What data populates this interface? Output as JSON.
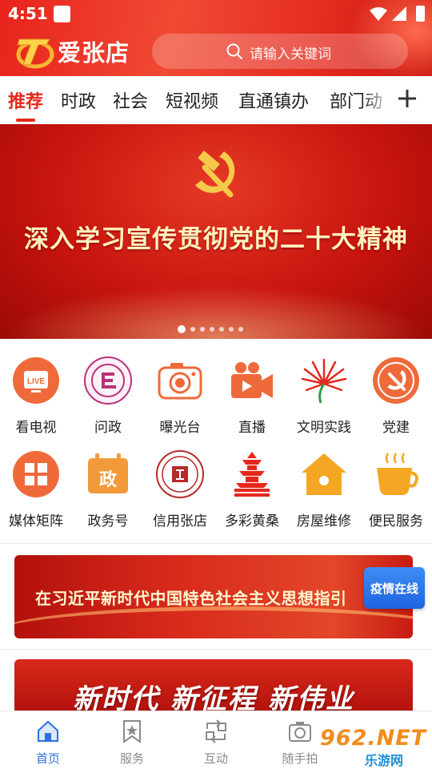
{
  "status_bar": {
    "time": "4:51"
  },
  "header": {
    "app_name": "爱张店",
    "search_placeholder": "请输入关键词"
  },
  "tabs": [
    {
      "label": "推荐",
      "active": true
    },
    {
      "label": "时政"
    },
    {
      "label": "社会"
    },
    {
      "label": "短视频"
    },
    {
      "label": "直通镇办"
    },
    {
      "label": "部门动"
    }
  ],
  "banner": {
    "text": "深入学习宣传贯彻党的二十大精神",
    "page_count": 7,
    "active_page": 1
  },
  "services": [
    {
      "label": "看电视",
      "icon": "live-tv-icon"
    },
    {
      "label": "问政",
      "icon": "wenzheng-icon"
    },
    {
      "label": "曝光台",
      "icon": "camera-icon"
    },
    {
      "label": "直播",
      "icon": "video-camera-icon"
    },
    {
      "label": "文明实践",
      "icon": "civilization-flower-icon"
    },
    {
      "label": "党建",
      "icon": "party-emblem-icon"
    },
    {
      "label": "媒体矩阵",
      "icon": "grid-matrix-icon"
    },
    {
      "label": "政务号",
      "icon": "gov-calendar-icon"
    },
    {
      "label": "信用张店",
      "icon": "credit-seal-icon"
    },
    {
      "label": "多彩黄桑",
      "icon": "pagoda-icon"
    },
    {
      "label": "房屋维修",
      "icon": "house-icon"
    },
    {
      "label": "便民服务",
      "icon": "coffee-cup-icon"
    }
  ],
  "promos": {
    "promo1_text": "在习近平新时代中国特色社会主义思想指引",
    "epidemic_badge": "疫情在线",
    "promo2_text": "新时代 新征程 新伟业"
  },
  "bottom_nav": [
    {
      "label": "首页",
      "active": true
    },
    {
      "label": "服务"
    },
    {
      "label": "互动"
    },
    {
      "label": "随手拍"
    }
  ],
  "watermark": {
    "top": "962.NET",
    "bottom": "乐游网"
  },
  "colors": {
    "brand_red": "#e5281d",
    "nav_active_blue": "#2f6fe0",
    "icon_orange": "#f06a35"
  }
}
